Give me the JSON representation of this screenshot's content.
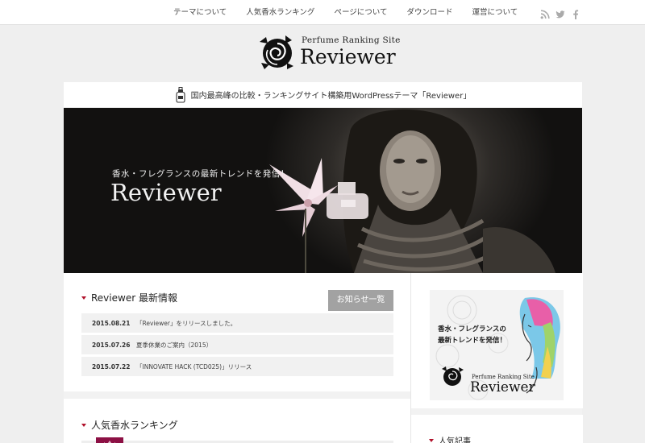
{
  "nav": {
    "items": [
      "テーマについて",
      "人気香水ランキング",
      "ページについて",
      "ダウンロード",
      "運営について"
    ],
    "social_icons": [
      "rss-icon",
      "twitter-icon",
      "facebook-icon"
    ]
  },
  "logo": {
    "sub": "Perfume Ranking Site",
    "main": "Reviewer"
  },
  "tagline": "国内最高峰の比較・ランキングサイト構築用WordPressテーマ「Reviewer」",
  "hero": {
    "kicker": "香水・フレグランスの最新トレンドを発信！",
    "brand": "Reviewer"
  },
  "news": {
    "title": "Reviewer 最新情報",
    "more_label": "お知らせ一覧",
    "items": [
      {
        "date": "2015.08.21",
        "title": "「Reviewer」をリリースしました。"
      },
      {
        "date": "2015.07.26",
        "title": "夏季休業のご案内（2015）"
      },
      {
        "date": "2015.07.22",
        "title": "「INNOVATE HACK (TCD025)」リリース"
      }
    ]
  },
  "ranking": {
    "title": "人気香水ランキング"
  },
  "sidebar": {
    "ad": {
      "line1": "香水・フレグランスの",
      "line2": "最新トレンドを発信！",
      "sub": "Perfume Ranking Site",
      "main": "Reviewer"
    },
    "popular_title": "人気記事"
  },
  "colors": {
    "accent": "#b0102a",
    "button": "#a2a2a2",
    "rank_badge": "#8c1044"
  }
}
